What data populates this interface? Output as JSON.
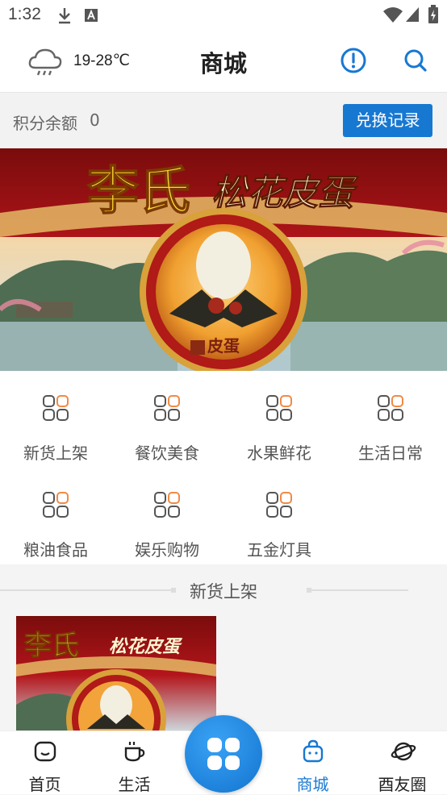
{
  "status_bar": {
    "time": "1:32"
  },
  "header": {
    "weather": "19-28℃",
    "title": "商城"
  },
  "points": {
    "label": "积分余额",
    "value": "0",
    "exchange_button": "兑换记录"
  },
  "banner": {
    "brand_text": "李氏松花皮蛋",
    "seal_text": "皮蛋",
    "stamp_text": "特产"
  },
  "categories": [
    {
      "label": "新货上架"
    },
    {
      "label": "餐饮美食"
    },
    {
      "label": "水果鲜花"
    },
    {
      "label": "生活日常"
    },
    {
      "label": "粮油食品"
    },
    {
      "label": "娱乐购物"
    },
    {
      "label": "五金灯具"
    }
  ],
  "section": {
    "title": "新货上架"
  },
  "tabs": [
    {
      "label": "首页",
      "icon": "home-icon"
    },
    {
      "label": "生活",
      "icon": "coffee-icon"
    },
    {
      "label": "",
      "icon": "app-grid-icon"
    },
    {
      "label": "商城",
      "icon": "shopping-bag-icon",
      "active": true
    },
    {
      "label": "酉友圈",
      "icon": "planet-icon"
    }
  ],
  "colors": {
    "accent": "#1778d2",
    "category_icon_orange": "#f08a45"
  }
}
